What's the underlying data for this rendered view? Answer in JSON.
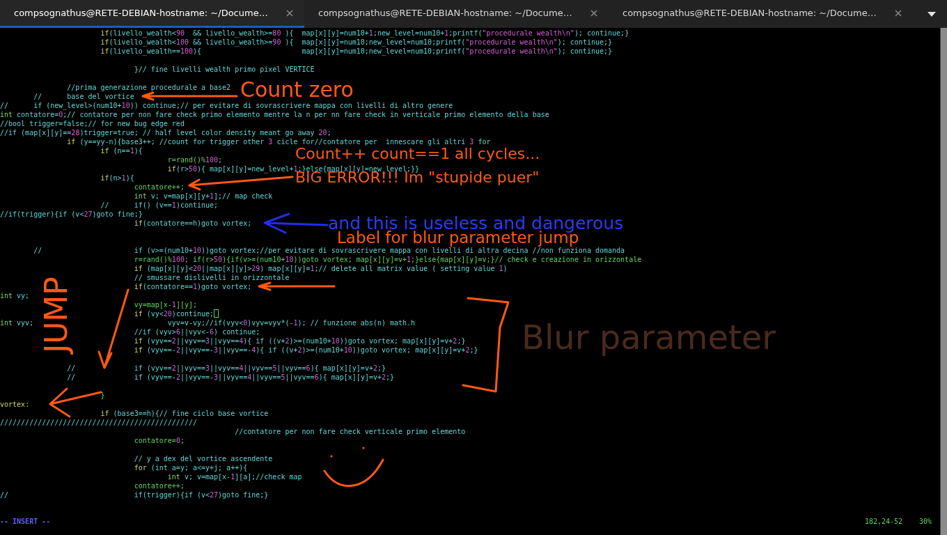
{
  "tabs": [
    {
      "title": "compsognathus@RETE-DEBIAN-hostname: ~/Docume…",
      "selected": true
    },
    {
      "title": "compsognathus@RETE-DEBIAN-hostname: ~/Docume…",
      "selected": false
    },
    {
      "title": "compsognathus@RETE-DEBIAN-hostname: ~/Docume…",
      "selected": false
    }
  ],
  "editor": {
    "lines": [
      {
        "kind": "control",
        "text": "\t\t\tif(livello_wealth<90  && livello_wealth>=80 ){  map[x][y]=num10+1;new_level=num10+1;printf(\"procedurale wealth\\n\"); continue;}",
        "cursor": false
      },
      {
        "kind": "control",
        "text": "\t\t\tif(livello_wealth<100 && livello_wealth>=90 ){  map[x][y]=num10;new_level=num10;printf(\"procedurale wealth\\n\"); continue;}",
        "cursor": false
      },
      {
        "kind": "control",
        "text": "\t\t\tif(livello_wealth==100){\t\t\tmap[x][y]=num10;new_level=num10;printf(\"procedurale wealth\\n\"); continue;}",
        "cursor": false
      },
      {
        "cursor": false
      },
      {
        "kind": "comment",
        "text": "\t\t\t\t}// fine livelli wealth primo pixel VERTICE",
        "cursor": false
      },
      {
        "cursor": false
      },
      {
        "kind": "comment",
        "text": "\t\t//prima generazione procedurale a base2",
        "cursor": false
      },
      {
        "kind": "comment",
        "text": "\t//\tbase del vortice",
        "cursor": false
      },
      {
        "kind": "comment",
        "text": "//\tif (new_level>(num10+10)) continue;// per evitare di sovrascrivere mappa con livelli di altro genere",
        "cursor": false
      },
      {
        "kind": "declaration",
        "text": "int contatore=0;// contatore per non fare check primo elemento mentre la n per nn fare check in verticale primo elemento della base",
        "cursor": false
      },
      {
        "kind": "comment",
        "text": "//bool trigger=false;// for new bug edge red",
        "cursor": false
      },
      {
        "kind": "comment",
        "text": "//if (map[x][y]==28)trigger=true; // half level color density meant go away 20;",
        "cursor": false
      },
      {
        "kind": "control",
        "text": "\t\tif (y==yy-n){base3++; //count for trigger other 3 cicle for//contatore per  innescare gli altri 3 for",
        "cursor": false
      },
      {
        "kind": "control",
        "text": "\t\t\tif (n==1){",
        "cursor": false
      },
      {
        "kind": "statement",
        "text": "\t\t\t\t\tr=rand()%100;",
        "cursor": false
      },
      {
        "kind": "control",
        "text": "\t\t\t\t\tif(r>50){ map[x][y]=new_level+1;}else{map[x][y]=new_level;}}",
        "cursor": false
      },
      {
        "kind": "control",
        "text": "\t\t\tif(n>1){",
        "cursor": false
      },
      {
        "kind": "statement",
        "text": "\t\t\t\tcontatore++;",
        "cursor": false
      },
      {
        "kind": "declaration",
        "text": "\t\t\t\tint v; v=map[x][y+1];// map check",
        "cursor": false
      },
      {
        "kind": "comment",
        "text": "\t\t\t//\tif() (v==1)continue;",
        "cursor": false
      },
      {
        "kind": "comment",
        "text": "//if(trigger){if (v<27)goto fine;}",
        "cursor": false
      },
      {
        "kind": "control",
        "text": "\t\t\t\tif(contatore==h)goto vortex;",
        "cursor": false
      },
      {
        "cursor": false
      },
      {
        "cursor": false
      },
      {
        "kind": "comment",
        "text": "\t//\t\t\tif (v>=(num10+10))goto vortex;//per evitare di sovrascrivere mappa con livelli di altra decina //non funziona domanda",
        "cursor": false
      },
      {
        "kind": "statement",
        "text": "\t\t\t\tr=rand()%100; if(r>50){if(v>=(num10+10))goto vortex; map[x][y]=v+1;}else{map[x][y]=v;}// check e creazione in orizzontale",
        "cursor": false
      },
      {
        "kind": "control",
        "text": "\t\t\t\tif (map[x][y]<20||map[x][y]>29) map[x][y]=1;// delete all matrix value ( setting value 1)",
        "cursor": false
      },
      {
        "kind": "comment",
        "text": "\t\t\t\t// smussare dislivelli in orizzontale",
        "cursor": false
      },
      {
        "kind": "control",
        "text": "\t\t\t\tif(contatore==1)goto vortex;",
        "cursor": false
      },
      {
        "kind": "declaration",
        "text": "int vy;",
        "cursor": false
      },
      {
        "kind": "statement",
        "text": "\t\t\t\tvy=map[x-1][y];",
        "cursor": false
      },
      {
        "kind": "control",
        "text": "\t\t\t\tif (vy<20)continue;",
        "cursor": true
      },
      {
        "kind": "declaration",
        "text": "int vyv;\t\t\t\tvyv=v-vy;//if(vyv<0)vyv=vyv*(-1); // funzione abs(n) math.h",
        "cursor": false
      },
      {
        "kind": "comment",
        "text": "\t\t\t\t//if (vyv>6||vyv<-6) continue;",
        "cursor": false
      },
      {
        "kind": "control",
        "text": "\t\t\t\tif (vyv==2||vyv==3||vyv==4){ if ((v+2)>=(num10+10))goto vortex; map[x][y]=v+2;}",
        "cursor": false
      },
      {
        "kind": "control",
        "text": "\t\t\t\tif (vyv==-2||vyv==-3||vyv==-4){ if ((v+2)>=(num10+10))goto vortex; map[x][y]=v+2;}",
        "cursor": false
      },
      {
        "cursor": false
      },
      {
        "kind": "comment",
        "text": "\t\t//\t\tif (vyv==2||vyv==3||vyv==4||vyv==5||vyv==6){ map[x][y]=v+2;}",
        "cursor": false
      },
      {
        "kind": "comment",
        "text": "\t\t//\t\tif (vyv==-2||vyv==-3||vyv==4||vyv==5||vyv==6){ map[x][y]=v+2;}",
        "cursor": false
      },
      {
        "cursor": false
      },
      {
        "kind": "statement",
        "text": "\t\t\t}",
        "cursor": false
      },
      {
        "kind": "label",
        "text": "vortex:",
        "cursor": false
      },
      {
        "kind": "control",
        "text": "\t\t\tif (base3==h){// fine ciclo base vortice",
        "cursor": false
      },
      {
        "kind": "comment",
        "text": "///////////////////////////////////////////////",
        "cursor": false
      },
      {
        "kind": "comment",
        "text": "\t\t\t\t\t\t\t//contatore per non fare check verticale primo elemento",
        "cursor": false
      },
      {
        "kind": "statement",
        "text": "\t\t\t\tcontatore=0;",
        "cursor": false
      },
      {
        "cursor": false
      },
      {
        "kind": "comment",
        "text": "\t\t\t\t// y a dex del vortice ascendente",
        "cursor": false
      },
      {
        "kind": "control",
        "text": "\t\t\t\tfor (int a=y; a<=y+j; a++){",
        "cursor": false
      },
      {
        "kind": "declaration",
        "text": "\t\t\t\t\tint v; v=map[x-1][a];//check map",
        "cursor": false
      },
      {
        "kind": "statement",
        "text": "\t\t\t\tcontatore++;",
        "cursor": false
      },
      {
        "kind": "comment",
        "text": "//\t\t\t\tif(trigger){if (v<27)goto fine;}",
        "cursor": false
      }
    ]
  },
  "annotations": [
    {
      "text": "Count zero",
      "color": "#ff5a14"
    },
    {
      "text": "Count++  count==1 all cycles...",
      "color": "#ff5a14"
    },
    {
      "text": "BIG ERROR!!! Im \"stupide puer\"",
      "color": "#ff5a14"
    },
    {
      "text": "and this is useless and dangerous",
      "color": "#2a3cf0"
    },
    {
      "text": "Label for blur parameter jump",
      "color": "#ff5a14"
    },
    {
      "text": "Blur parameter",
      "color": "#4a2a1e"
    },
    {
      "text": "JUMP",
      "color": "#ff5a14"
    }
  ],
  "status_bar": {
    "mode": "-- INSERT --",
    "position": "182,24-52",
    "scroll": "30%"
  }
}
